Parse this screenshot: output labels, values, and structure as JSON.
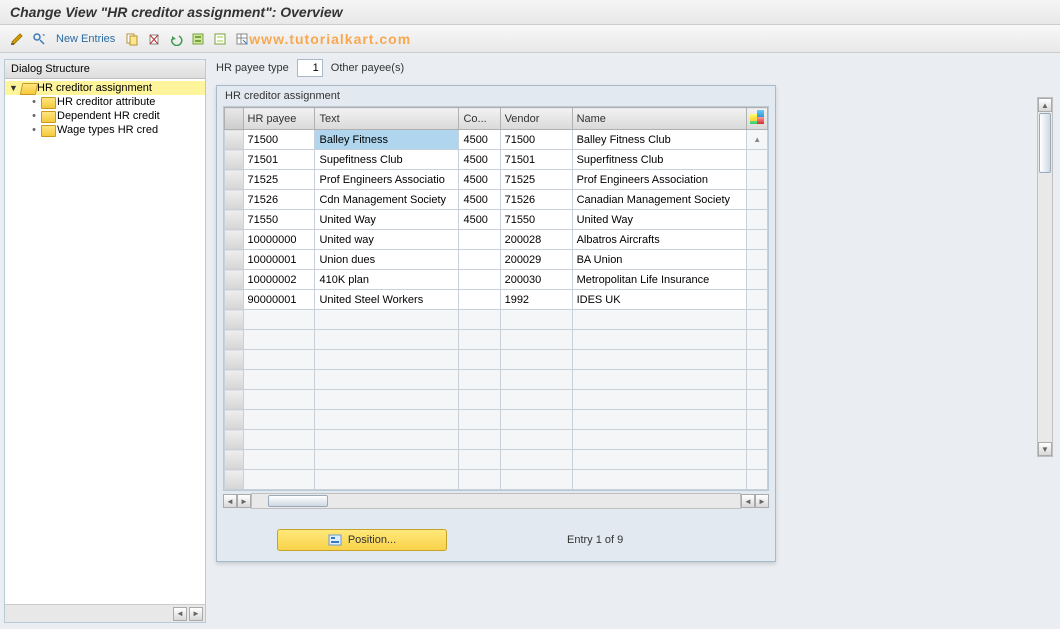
{
  "title": "Change View \"HR creditor assignment\": Overview",
  "toolbar": {
    "new_entries_label": "New Entries",
    "watermark": "www.tutorialkart.com"
  },
  "tree": {
    "header": "Dialog Structure",
    "items": [
      {
        "label": "HR creditor assignment",
        "open": true,
        "selected": true,
        "level": 0
      },
      {
        "label": "HR creditor attribute",
        "open": false,
        "selected": false,
        "level": 1
      },
      {
        "label": "Dependent HR credit",
        "open": false,
        "selected": false,
        "level": 1
      },
      {
        "label": "Wage types HR cred",
        "open": false,
        "selected": false,
        "level": 1
      }
    ]
  },
  "field": {
    "label": "HR payee type",
    "value": "1",
    "desc": "Other payee(s)"
  },
  "group": {
    "title": "HR creditor assignment",
    "columns": {
      "hr_payee": "HR payee",
      "text": "Text",
      "co": "Co...",
      "vendor": "Vendor",
      "name": "Name"
    },
    "rows": [
      {
        "hr_payee": "71500",
        "text": "Balley Fitness",
        "co": "4500",
        "vendor": "71500",
        "name": "Balley Fitness Club",
        "selected_text": true
      },
      {
        "hr_payee": "71501",
        "text": "Supefitness Club",
        "co": "4500",
        "vendor": "71501",
        "name": "Superfitness Club"
      },
      {
        "hr_payee": "71525",
        "text": "Prof Engineers Associatio",
        "co": "4500",
        "vendor": "71525",
        "name": "Prof  Engineers Association"
      },
      {
        "hr_payee": "71526",
        "text": "Cdn Management Society",
        "co": "4500",
        "vendor": "71526",
        "name": "Canadian Management Society"
      },
      {
        "hr_payee": "71550",
        "text": "United Way",
        "co": "4500",
        "vendor": "71550",
        "name": "United Way"
      },
      {
        "hr_payee": "10000000",
        "text": "United way",
        "co": "",
        "vendor": "200028",
        "name": "Albatros Aircrafts"
      },
      {
        "hr_payee": "10000001",
        "text": "Union dues",
        "co": "",
        "vendor": "200029",
        "name": "BA Union"
      },
      {
        "hr_payee": "10000002",
        "text": "410K plan",
        "co": "",
        "vendor": "200030",
        "name": "Metropolitan Life Insurance"
      },
      {
        "hr_payee": "90000001",
        "text": "United Steel Workers",
        "co": "",
        "vendor": "1992",
        "name": "IDES UK"
      }
    ],
    "empty_rows": 9
  },
  "footer": {
    "position_label": "Position...",
    "entry_text": "Entry 1 of 9"
  }
}
